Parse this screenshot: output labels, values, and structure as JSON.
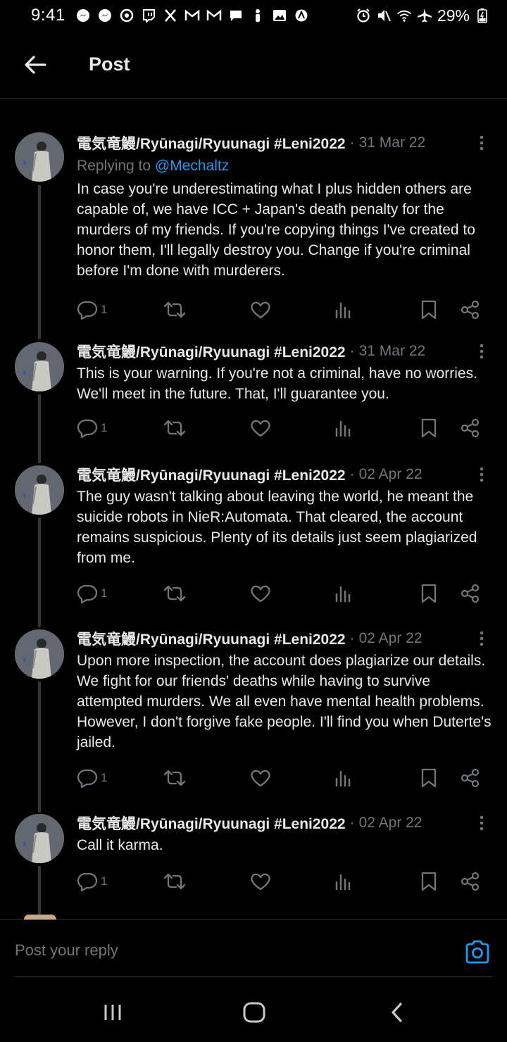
{
  "status_bar": {
    "time": "9:41",
    "battery": "29%",
    "notification_icons": [
      "messenger-icon",
      "messenger-icon",
      "threads-icon",
      "twitch-icon",
      "x-icon",
      "gmail-icon",
      "gmail-icon",
      "chat-icon",
      "person-icon",
      "gallery-icon",
      "app-icon"
    ],
    "system_icons": [
      "alarm-icon",
      "mute-icon",
      "wifi-icon",
      "airplane-icon",
      "battery-icon"
    ]
  },
  "header": {
    "title": "Post"
  },
  "posts": [
    {
      "author": "電気竜鰻/Ryūnagi/Ryuunagi #Leni2022",
      "date": "31 Mar 22",
      "reply_prefix": "Replying to ",
      "reply_mention": "@Mechaltz",
      "text": "In case you're underestimating what I plus hidden others are capable of, we have ICC + Japan's death penalty for the murders of my friends. If you're copying things I've created to honor them, I'll legally destroy you. Change if you're criminal before I'm done with murderers.",
      "reply_count": "1"
    },
    {
      "author": "電気竜鰻/Ryūnagi/Ryuunagi #Leni2022",
      "date": "31 Mar 22",
      "text": "This is your warning. If you're not a criminal, have no worries. We'll meet in the future. That, I'll guarantee you.",
      "reply_count": "1"
    },
    {
      "author": "電気竜鰻/Ryūnagi/Ryuunagi #Leni2022",
      "date": "02 Apr 22",
      "text": "The guy wasn't talking about leaving the world, he meant the suicide robots in NieR:Automata. That cleared, the account remains suspicious. Plenty of its details just seem plagiarized from me.",
      "reply_count": "1"
    },
    {
      "author": "電気竜鰻/Ryūnagi/Ryuunagi #Leni2022",
      "date": "02 Apr 22",
      "text": "Upon more inspection, the account does plagiarize our details. We fight for our friends' deaths while having to survive attempted murders. We all even have mental health problems. However, I don't forgive fake people. I'll find you when Duterte's jailed.",
      "reply_count": "1"
    },
    {
      "author": "電気竜鰻/Ryūnagi/Ryuunagi #Leni2022",
      "date": "02 Apr 22",
      "text": "Call it karma.",
      "reply_count": "1"
    }
  ],
  "composer": {
    "placeholder": "Post your reply"
  },
  "colors": {
    "background": "#000000",
    "text": "#e7e9ea",
    "secondary": "#71767b",
    "accent": "#1d9bf0",
    "divider": "#2f3336"
  }
}
